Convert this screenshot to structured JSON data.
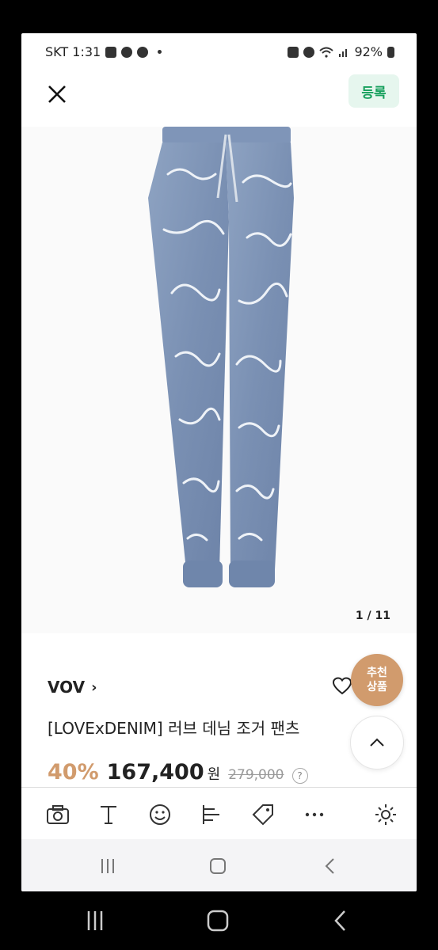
{
  "status": {
    "carrier_time": "SKT 1:31",
    "battery": "92%"
  },
  "topbar": {
    "register_label": "등록"
  },
  "image": {
    "counter": "1 / 11"
  },
  "floating": {
    "recommended_label_line1": "추천",
    "recommended_label_line2": "상품"
  },
  "product": {
    "brand": "VOV",
    "title": "[LOVExDENIM] 러브 데님 조거 팬츠",
    "discount": "40%",
    "price": "167,400",
    "currency": "원",
    "original_price": "279,000"
  },
  "toolbar": {
    "icons": [
      "camera-icon",
      "text-icon",
      "emoji-icon",
      "align-icon",
      "tag-icon",
      "more-icon",
      "settings-icon"
    ]
  },
  "colors": {
    "accent_green": "#17a05d",
    "discount_brown": "#d19b6d"
  }
}
